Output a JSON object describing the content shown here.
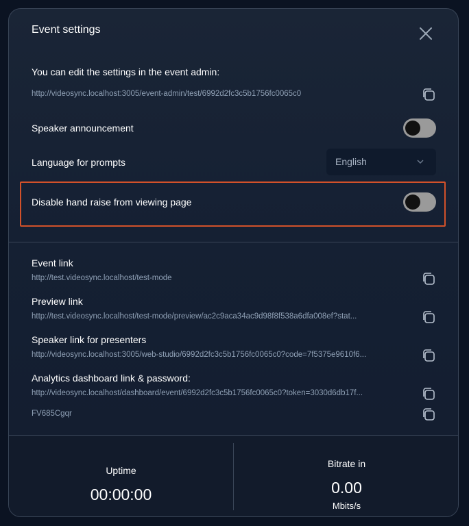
{
  "modal": {
    "title": "Event settings",
    "close_icon": "close-icon"
  },
  "settings": {
    "admin_hint": "You can edit the settings in the event admin:",
    "admin_url": "http://videosync.localhost:3005/event-admin/test/6992d2fc3c5b1756fc0065c0",
    "speaker_announcement": {
      "label": "Speaker announcement",
      "enabled": false
    },
    "language": {
      "label": "Language for prompts",
      "selected": "English"
    },
    "disable_hand_raise": {
      "label": "Disable hand raise from viewing page",
      "enabled": false
    }
  },
  "links": [
    {
      "label": "Event link",
      "url": "http://test.videosync.localhost/test-mode"
    },
    {
      "label": "Preview link",
      "url": "http://test.videosync.localhost/test-mode/preview/ac2c9aca34ac9d98f8f538a6dfa008ef?stat..."
    },
    {
      "label": "Speaker link for presenters",
      "url": "http://videosync.localhost:3005/web-studio/6992d2fc3c5b1756fc0065c0?code=7f5375e9610f6..."
    },
    {
      "label": "Analytics dashboard link & password:",
      "url": "http://videosync.localhost/dashboard/event/6992d2fc3c5b1756fc0065c0?token=3030d6db17f...",
      "password": "FV685Cgqr"
    }
  ],
  "stats": {
    "uptime": {
      "label": "Uptime",
      "value": "00:00:00"
    },
    "bitrate": {
      "label": "Bitrate in",
      "value": "0.00",
      "unit": "Mbits/s"
    }
  },
  "colors": {
    "background": "#0b1322",
    "modal": "#172234",
    "highlight_border": "#d2512a",
    "toggle_track": "#9a9a9a"
  }
}
